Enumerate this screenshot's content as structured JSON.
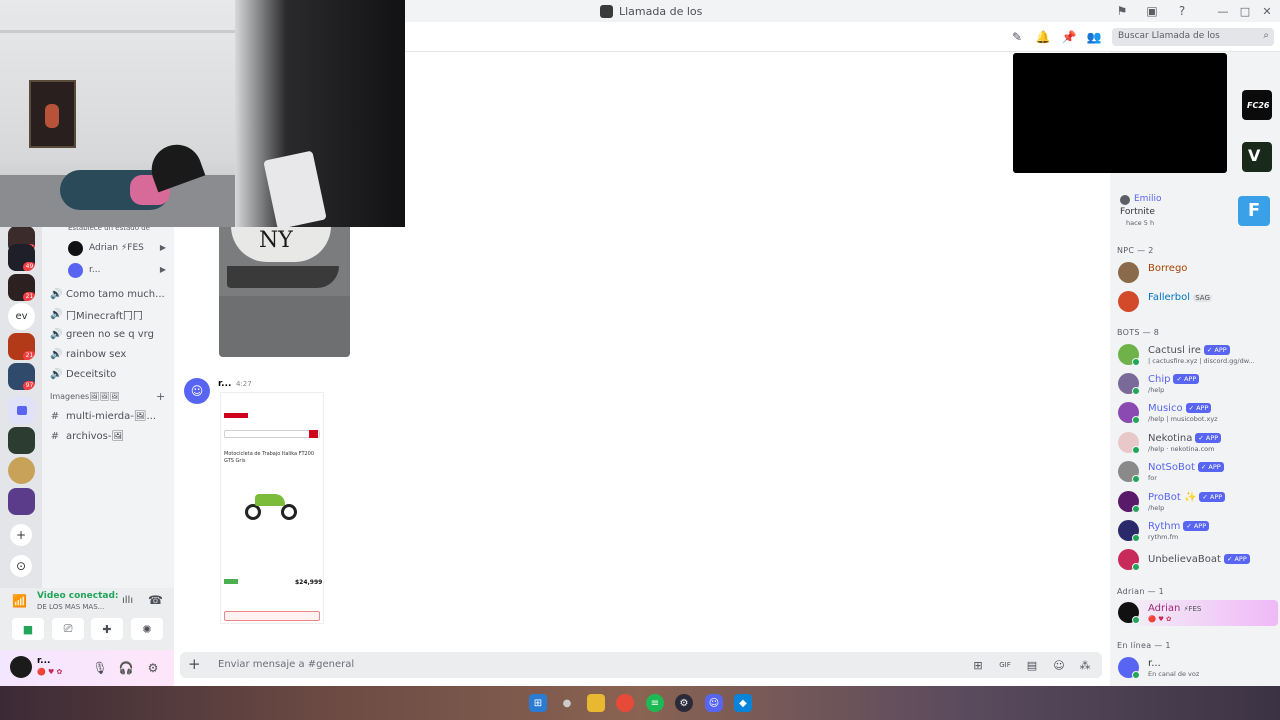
{
  "window": {
    "title": "Llamada de los",
    "icons": [
      "inbox-icon",
      "screen-icon",
      "help-icon"
    ]
  },
  "header": {
    "search_placeholder": "Buscar Llamada de los",
    "icons": [
      "threads-icon",
      "bell-icon",
      "pin-icon",
      "members-icon"
    ]
  },
  "rail": {
    "servers": [
      {
        "badge": "17",
        "color": "#3b2b2b"
      },
      {
        "badge": "49",
        "color": "#1f1f2a"
      },
      {
        "badge": "21",
        "color": "#2c2020"
      },
      {
        "text": "ev"
      },
      {
        "badge": "21",
        "color": "#b33a19"
      },
      {
        "badge": "97",
        "color": "#2f4a6a"
      },
      {
        "color": "#5865f2"
      },
      {
        "color": "#2d3c30"
      },
      {
        "color": "#c9a25a"
      },
      {
        "color": "#5a3c8a"
      }
    ],
    "add_label": "+",
    "discover_label": "⊙"
  },
  "channels": {
    "status_hint": "Establece un estado de",
    "voice_users": [
      {
        "name": "Adrian ⚡FES",
        "color": "#111111"
      },
      {
        "name": "r...",
        "color": "#5865f2"
      }
    ],
    "voice_channels": [
      "Como tamo much...",
      "冂Minecraft冂冂",
      "green no se q vrg",
      "rainbow sex",
      "Deceitsito"
    ],
    "category": "Imagenes🖼🖼🖼",
    "text_channels": [
      "multi-mierda-🖼...",
      "archivos-🖼"
    ]
  },
  "voice_panel": {
    "status": "Video conectad:",
    "channel": "DE LOS MAS MAS...",
    "user_name": "r...",
    "user_status": "🔴 ♥ ✿"
  },
  "chat": {
    "message_author": "r...",
    "message_time": "4:27",
    "product_title": "Motocicleta de Trabajo Italika FT200 GTS Gris",
    "price": "$24,999",
    "composer_placeholder": "Enviar mensaje a #general",
    "composer_icons": [
      "gift-icon",
      "gif-icon",
      "sticker-icon",
      "emoji-icon",
      "apps-icon"
    ]
  },
  "members": {
    "activity": {
      "name": "Emilio",
      "game": "Fortnite",
      "time": "hace 5 h"
    },
    "npc_header": "NPC — 2",
    "npcs": [
      {
        "name": "Borrego",
        "color": "#a84300",
        "av": "#8a6a4a"
      },
      {
        "name": "Fallerbol",
        "color": "#0075c2",
        "av": "#d24a2a",
        "tag": "SAG"
      }
    ],
    "bots_header": "BOTS — 8",
    "bots": [
      {
        "name": "Cactusl ire",
        "sub": "| cactusfire.xyz | discord.gg/dw...",
        "color": "#4e5058",
        "av": "#6fb24a"
      },
      {
        "name": "Chip",
        "sub": "/help",
        "color": "#5865f2",
        "av": "#7a6a9a"
      },
      {
        "name": "Musico",
        "sub": "/help | musicobot.xyz",
        "color": "#5865f2",
        "av": "#8a4ab2"
      },
      {
        "name": "Nekotina",
        "sub": "/help · nekotina.com",
        "color": "#4e5058",
        "av": "#e8c8c8"
      },
      {
        "name": "NotSoBot",
        "sub": "for",
        "color": "#5865f2",
        "av": "#8a8a8a"
      },
      {
        "name": "ProBot ✨",
        "sub": "/help",
        "color": "#5865f2",
        "av": "#5a1a6a"
      },
      {
        "name": "Rythm",
        "sub": "rythm.fm",
        "color": "#5865f2",
        "av": "#2a2a6a"
      },
      {
        "name": "UnbelievaBoat",
        "sub": "",
        "color": "#4e5058",
        "av": "#c82a5a"
      }
    ],
    "app_badge": "✓ APP",
    "adrian_header": "Adrian — 1",
    "adrian": {
      "name": "Adrian",
      "tag": "⚡FES"
    },
    "online_header": "En línea — 1",
    "online": {
      "name": "r...",
      "sub": "En canal de voz"
    }
  },
  "taskbar": {
    "apps": [
      "windows",
      "search",
      "files",
      "chrome",
      "spotify",
      "steam",
      "discord",
      "store"
    ]
  }
}
